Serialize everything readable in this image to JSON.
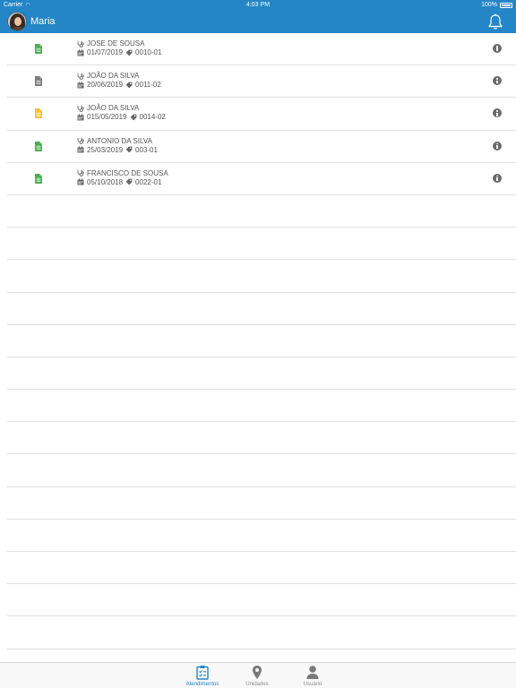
{
  "status_bar": {
    "carrier": "Carrier",
    "time": "4:03 PM",
    "battery": "100%"
  },
  "header": {
    "user_name": "Maria",
    "avatar_icon": "user-photo",
    "notification_icon": "bell-icon"
  },
  "colors": {
    "brand": "#2486c6",
    "doc_green": "#4caf50",
    "doc_gray": "#7d7d7d",
    "doc_yellow": "#f5c242"
  },
  "atendimentos": [
    {
      "name": "JOSE DE SOUSA",
      "date": "01/07/2019",
      "code": "0010-01",
      "doc_color": "#4caf50"
    },
    {
      "name": "JOÃO DA SILVA",
      "date": "20/06/2019",
      "code": "0011-02",
      "doc_color": "#7d7d7d"
    },
    {
      "name": "JOÃO DA SILVA",
      "date": "015/05/2019",
      "code": "0014-02",
      "doc_color": "#f5c242"
    },
    {
      "name": "ANTONIO DA SILVA",
      "date": "25/03/2019",
      "code": "003-01",
      "doc_color": "#4caf50"
    },
    {
      "name": "FRANCISCO DE SOUSA",
      "date": "05/10/2018",
      "code": "0022-01",
      "doc_color": "#4caf50"
    }
  ],
  "empty_rows": 14,
  "tabs": [
    {
      "label": "Atendimentos",
      "icon": "clipboard-check-icon",
      "active": true
    },
    {
      "label": "Unidades",
      "icon": "map-pin-icon",
      "active": false
    },
    {
      "label": "Usuário",
      "icon": "user-icon",
      "active": false
    }
  ]
}
